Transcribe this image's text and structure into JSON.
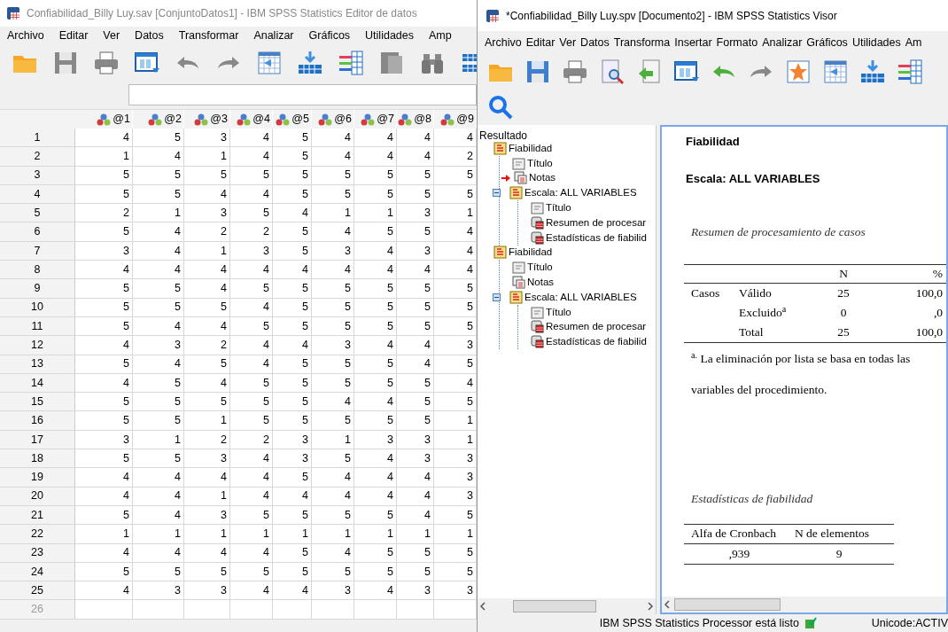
{
  "editor": {
    "title": "Confiabilidad_Billy Luy.sav [ConjuntoDatos1] - IBM SPSS Statistics Editor de datos",
    "menu": [
      "Archivo",
      "Editar",
      "Ver",
      "Datos",
      "Transformar",
      "Analizar",
      "Gráficos",
      "Utilidades",
      "Amp"
    ],
    "grid": {
      "columns": [
        "@1",
        "@2",
        "@3",
        "@4",
        "@5",
        "@6",
        "@7",
        "@8",
        "@9"
      ],
      "rows": [
        {
          "number": "1",
          "cells": [
            "4",
            "5",
            "3",
            "4",
            "5",
            "4",
            "4",
            "4",
            "4"
          ]
        },
        {
          "number": "2",
          "cells": [
            "1",
            "4",
            "1",
            "4",
            "5",
            "4",
            "4",
            "4",
            "2"
          ]
        },
        {
          "number": "3",
          "cells": [
            "5",
            "5",
            "5",
            "5",
            "5",
            "5",
            "5",
            "5",
            "5"
          ]
        },
        {
          "number": "4",
          "cells": [
            "5",
            "5",
            "4",
            "4",
            "5",
            "5",
            "5",
            "5",
            "5"
          ]
        },
        {
          "number": "5",
          "cells": [
            "2",
            "1",
            "3",
            "5",
            "4",
            "1",
            "1",
            "3",
            "1"
          ]
        },
        {
          "number": "6",
          "cells": [
            "5",
            "4",
            "2",
            "2",
            "5",
            "4",
            "5",
            "5",
            "4"
          ]
        },
        {
          "number": "7",
          "cells": [
            "3",
            "4",
            "1",
            "3",
            "5",
            "3",
            "4",
            "3",
            "4"
          ]
        },
        {
          "number": "8",
          "cells": [
            "4",
            "4",
            "4",
            "4",
            "4",
            "4",
            "4",
            "4",
            "4"
          ]
        },
        {
          "number": "9",
          "cells": [
            "5",
            "5",
            "4",
            "5",
            "5",
            "5",
            "5",
            "5",
            "5"
          ]
        },
        {
          "number": "10",
          "cells": [
            "5",
            "5",
            "5",
            "4",
            "5",
            "5",
            "5",
            "5",
            "5"
          ]
        },
        {
          "number": "11",
          "cells": [
            "5",
            "4",
            "4",
            "5",
            "5",
            "5",
            "5",
            "5",
            "5"
          ]
        },
        {
          "number": "12",
          "cells": [
            "4",
            "3",
            "2",
            "4",
            "4",
            "3",
            "4",
            "4",
            "3"
          ]
        },
        {
          "number": "13",
          "cells": [
            "5",
            "4",
            "5",
            "4",
            "5",
            "5",
            "5",
            "4",
            "5"
          ]
        },
        {
          "number": "14",
          "cells": [
            "4",
            "5",
            "4",
            "5",
            "5",
            "5",
            "5",
            "5",
            "4"
          ]
        },
        {
          "number": "15",
          "cells": [
            "5",
            "5",
            "5",
            "5",
            "5",
            "4",
            "4",
            "5",
            "5"
          ]
        },
        {
          "number": "16",
          "cells": [
            "5",
            "5",
            "1",
            "5",
            "5",
            "5",
            "5",
            "5",
            "1"
          ]
        },
        {
          "number": "17",
          "cells": [
            "3",
            "1",
            "2",
            "2",
            "3",
            "1",
            "3",
            "3",
            "1"
          ]
        },
        {
          "number": "18",
          "cells": [
            "5",
            "5",
            "3",
            "4",
            "3",
            "5",
            "4",
            "3",
            "3"
          ]
        },
        {
          "number": "19",
          "cells": [
            "4",
            "4",
            "4",
            "4",
            "5",
            "4",
            "4",
            "4",
            "3"
          ]
        },
        {
          "number": "20",
          "cells": [
            "4",
            "4",
            "1",
            "4",
            "4",
            "4",
            "4",
            "4",
            "3"
          ]
        },
        {
          "number": "21",
          "cells": [
            "5",
            "4",
            "3",
            "5",
            "5",
            "5",
            "5",
            "4",
            "5"
          ]
        },
        {
          "number": "22",
          "cells": [
            "1",
            "1",
            "1",
            "1",
            "1",
            "1",
            "1",
            "1",
            "1"
          ]
        },
        {
          "number": "23",
          "cells": [
            "4",
            "4",
            "4",
            "4",
            "5",
            "4",
            "5",
            "5",
            "5"
          ]
        },
        {
          "number": "24",
          "cells": [
            "5",
            "5",
            "5",
            "5",
            "5",
            "5",
            "5",
            "5",
            "5"
          ]
        },
        {
          "number": "25",
          "cells": [
            "4",
            "3",
            "3",
            "4",
            "4",
            "3",
            "4",
            "3",
            "3"
          ]
        },
        {
          "number": "26"
        }
      ]
    }
  },
  "viewer": {
    "title": "*Confiabilidad_Billy Luy.spv [Documento2] - IBM SPSS Statistics Visor",
    "menu": [
      "Archivo",
      "Editar",
      "Ver",
      "Datos",
      "Transforma",
      "Insertar",
      "Formato",
      "Analizar",
      "Gráficos",
      "Utilidades",
      "Am"
    ],
    "outline": {
      "root": "Resultado",
      "items": [
        {
          "label": "Fiabilidad",
          "kind": "book",
          "current": false,
          "children": [
            {
              "label": "Título",
              "kind": "title",
              "current": false
            },
            {
              "label": "Notas",
              "kind": "notes",
              "current": true
            },
            {
              "label": "Escala: ALL VARIABLES",
              "kind": "book",
              "current": false,
              "expanded": true,
              "children": [
                {
                  "label": "Título",
                  "kind": "title",
                  "current": false
                },
                {
                  "label": "Resumen de procesar",
                  "kind": "table",
                  "current": false
                },
                {
                  "label": "Estadísticas de fiabilid",
                  "kind": "table",
                  "current": false
                }
              ]
            }
          ]
        },
        {
          "label": "Fiabilidad",
          "kind": "book",
          "current": false,
          "children": [
            {
              "label": "Título",
              "kind": "title",
              "current": false
            },
            {
              "label": "Notas",
              "kind": "notes",
              "current": false
            },
            {
              "label": "Escala: ALL VARIABLES",
              "kind": "book",
              "current": false,
              "expanded": true,
              "children": [
                {
                  "label": "Título",
                  "kind": "title",
                  "current": false
                },
                {
                  "label": "Resumen de procesar",
                  "kind": "table",
                  "current": false
                },
                {
                  "label": "Estadísticas de fiabilid",
                  "kind": "table",
                  "current": false
                }
              ]
            }
          ]
        }
      ]
    },
    "output": {
      "heading": "Fiabilidad",
      "subheading": "Escala: ALL VARIABLES",
      "case_summary": {
        "title": "Resumen de procesamiento de casos",
        "columns": [
          "N",
          "%"
        ],
        "group": "Casos",
        "rows": [
          {
            "label": "Válido",
            "n": "25",
            "pct": "100,0"
          },
          {
            "label": "Excluido$^{a}$",
            "n": "0",
            "pct": ",0"
          },
          {
            "label": "Total",
            "n": "25",
            "pct": "100,0"
          }
        ],
        "footnote": "$^{a.}$ La eliminación por lista se basa en todas las variables del procedimiento."
      },
      "reliability": {
        "title": "Estadísticas de fiabilidad",
        "columns": [
          "Alfa de Cronbach",
          "N de elementos"
        ],
        "values": [
          ",939",
          "9"
        ]
      }
    },
    "status": {
      "message": "IBM SPSS Statistics Processor está listo",
      "encoding": "Unicode:ACTIV"
    }
  }
}
